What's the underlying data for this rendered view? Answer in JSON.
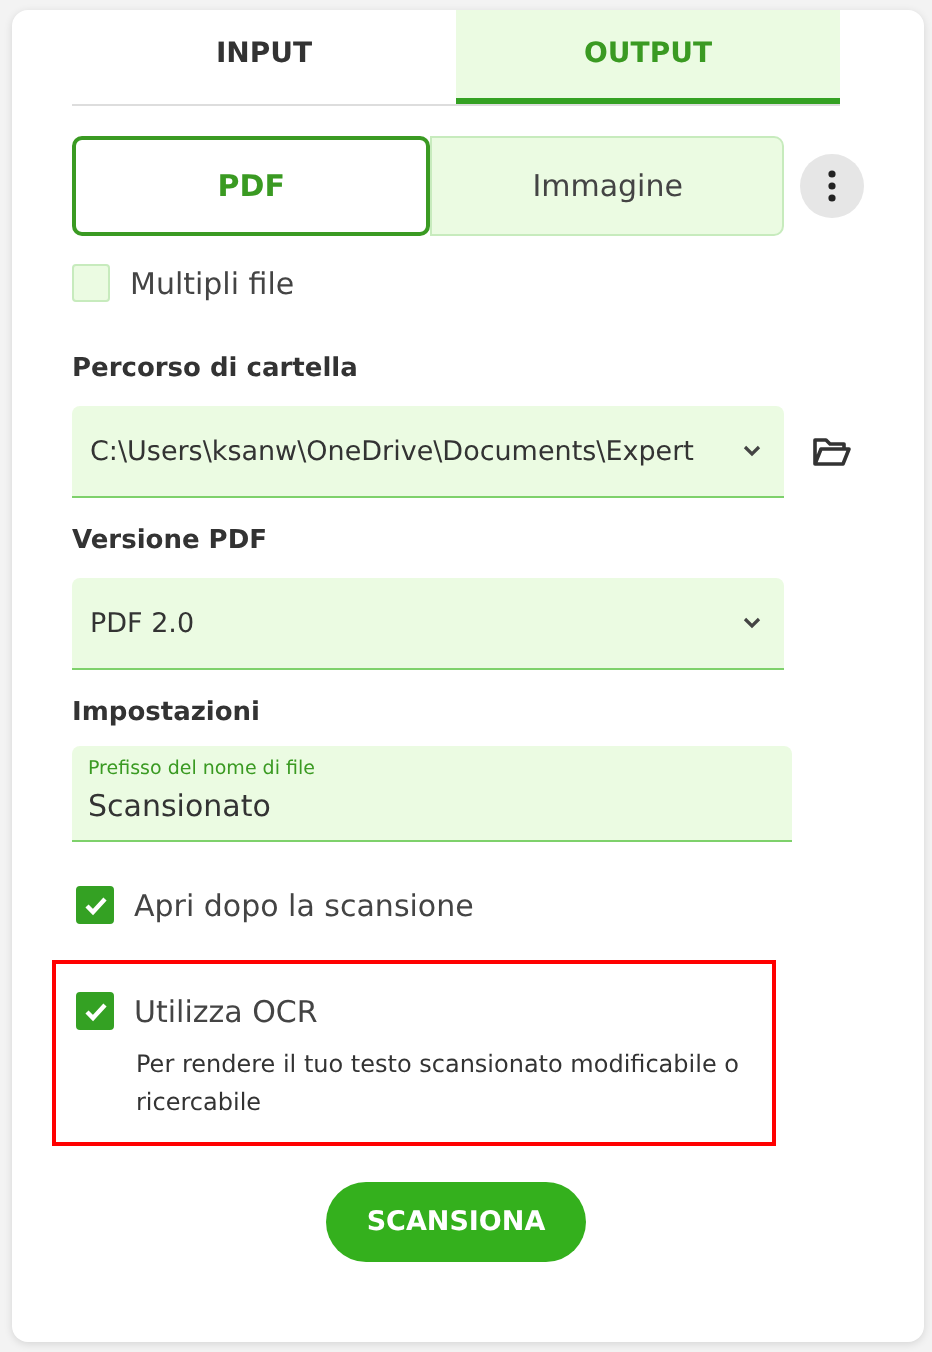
{
  "tabs": [
    {
      "label": "INPUT",
      "selected": false
    },
    {
      "label": "OUTPUT",
      "selected": true
    }
  ],
  "formats": [
    {
      "label": "PDF",
      "selected": true
    },
    {
      "label": "Immagine",
      "selected": false
    }
  ],
  "multiple_files": {
    "label": "Multipli file",
    "checked": false
  },
  "folder_path": {
    "label": "Percorso di cartella",
    "value": "C:\\Users\\ksanw\\OneDrive\\Documents\\Expert"
  },
  "pdf_version": {
    "label": "Versione PDF",
    "value": "PDF 2.0"
  },
  "settings": {
    "heading": "Impostazioni",
    "filename_prefix": {
      "label": "Prefisso del nome di file",
      "value": "Scansionato"
    },
    "options": [
      {
        "label": "Apri dopo la scansione",
        "checked": true,
        "highlighted": false
      },
      {
        "label": "Utilizza OCR",
        "checked": true,
        "highlighted": true,
        "description": "Per rendere il tuo testo scansionato modificabile o ricercabile"
      }
    ]
  },
  "scan_button": "SCANSIONA"
}
